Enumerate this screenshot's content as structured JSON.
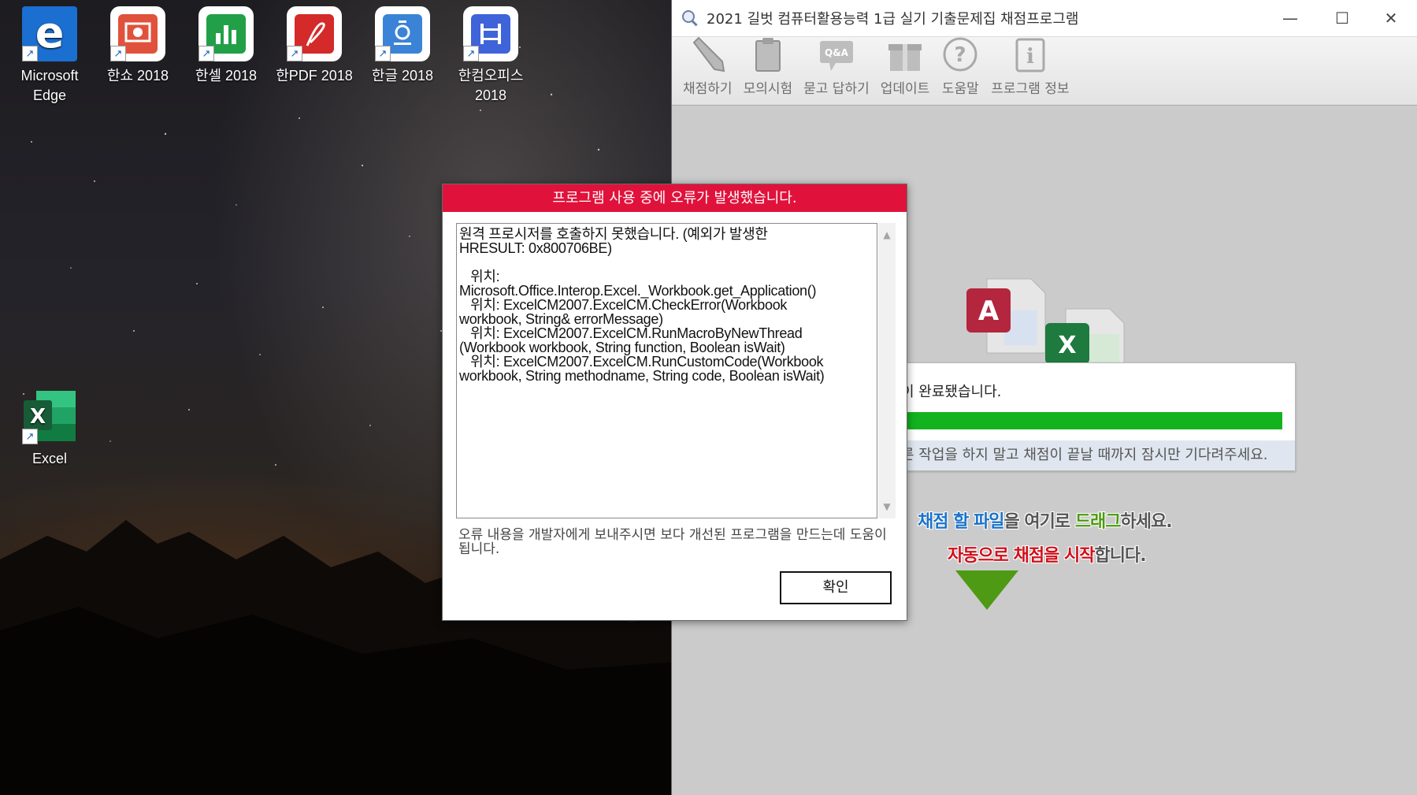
{
  "desktop": {
    "icons": [
      {
        "id": "edge",
        "label": "Microsoft Edge",
        "icon": "edge-icon",
        "color": "#1a6fd1"
      },
      {
        "id": "hanshow",
        "label": "한쇼 2018",
        "icon": "hanshow-icon",
        "color": "#e0523c"
      },
      {
        "id": "hancell",
        "label": "한셀 2018",
        "icon": "hancell-icon",
        "color": "#21a047"
      },
      {
        "id": "hanpdf",
        "label": "한PDF 2018",
        "icon": "hanpdf-icon",
        "color": "#d42a2a"
      },
      {
        "id": "hangul",
        "label": "한글 2018",
        "icon": "hangul-icon",
        "color": "#3b83d6"
      },
      {
        "id": "hancomoffice",
        "label": "한컴오피스 2018",
        "icon": "hancomoffice-icon",
        "color": "#3f63d8"
      },
      {
        "id": "excel",
        "label": "Excel",
        "icon": "excel-icon",
        "color": "#1d7044"
      }
    ]
  },
  "app": {
    "title": "2021 길벗 컴퓨터활용능력 1급 실기 기출문제집 채점프로그램",
    "toolbar": [
      {
        "label": "채점하기",
        "icon": "pencil-icon"
      },
      {
        "label": "모의시험",
        "icon": "clipboard-icon"
      },
      {
        "label": "묻고 답하기",
        "icon": "qa-bubble-icon"
      },
      {
        "label": "업데이트",
        "icon": "gift-icon"
      },
      {
        "label": "도움말",
        "icon": "help-icon"
      },
      {
        "label": "프로그램 정보",
        "icon": "info-icon"
      }
    ],
    "progress": {
      "text": "이 완료됐습니다.",
      "value": 1.0,
      "hint": "른 작업을 하지 말고 채점이 끝날 때까지 잠시만 기다려주세요."
    },
    "drop": {
      "line1": [
        "채점 할 파일",
        "을 여기로 ",
        "드래그",
        "하세요."
      ],
      "line2": [
        "자동으로 채점을 시작",
        "합니다."
      ]
    }
  },
  "dialog": {
    "title": "프로그램 사용 중에 오류가 발생했습니다.",
    "message": "원격 프로시저를 호출하지 못했습니다. (예외가 발생한\nHRESULT: 0x800706BE)\n\n   위치:\nMicrosoft.Office.Interop.Excel._Workbook.get_Application()\n   위치: ExcelCM2007.ExcelCM.CheckError(Workbook\nworkbook, String& errorMessage)\n   위치: ExcelCM2007.ExcelCM.RunMacroByNewThread\n(Workbook workbook, String function, Boolean isWait)\n   위치: ExcelCM2007.ExcelCM.RunCustomCode(Workbook\nworkbook, String methodname, String code, Boolean isWait)",
    "note": "오류 내용을 개발자에게 보내주시면 보다 개선된 프로그램을 만드는데 도움이 됩니다.",
    "ok_label": "확인",
    "accent": "#e0123b"
  }
}
